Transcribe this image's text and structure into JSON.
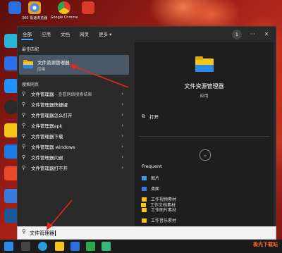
{
  "desktop": {
    "top_icons": [
      {
        "label": "",
        "color": "#2a6fe0",
        "icon": "shield-icon"
      },
      {
        "label": "360 极速浏览器",
        "color": "#4a90e2",
        "icon": "browser-icon"
      },
      {
        "label": "Google Chrome",
        "color": "#e8a020",
        "icon": "chrome-icon"
      },
      {
        "label": "",
        "color": "#d83a2a",
        "icon": "app-icon"
      }
    ],
    "side_icons_colors": [
      "#2ab3d8",
      "#2a70e8",
      "#1e90ff",
      "#2a6fe0",
      "#f5c518",
      "#1b7ce8",
      "#e84a2a",
      "#2a2a2a",
      "#1a5a9a",
      "#3a7ad8"
    ]
  },
  "start_menu": {
    "tabs": [
      "全部",
      "应用",
      "文档",
      "网页",
      "更多"
    ],
    "more_chevron": "▾",
    "notification_count": "1",
    "best_match_label": "最佳匹配",
    "best_match": {
      "title": "文件资源管理器",
      "subtitle": "应用"
    },
    "web_label": "搜索网页",
    "web_results": [
      {
        "text": "文件管理器",
        "hint": " - 查看网络搜索结果"
      },
      {
        "text": "文件管理器快捷键",
        "hint": ""
      },
      {
        "text": "文件管理器怎么打开",
        "hint": ""
      },
      {
        "text": "文件管理器apk",
        "hint": ""
      },
      {
        "text": "文件管理器下载",
        "hint": ""
      },
      {
        "text": "文件管理器 windows",
        "hint": ""
      },
      {
        "text": "文件管理器闪退",
        "hint": ""
      },
      {
        "text": "文件管理器打不开",
        "hint": ""
      }
    ],
    "preview": {
      "app_name": "文件资源管理器",
      "app_type": "应用",
      "open_label": "打开",
      "frequent_label": "Frequent",
      "frequent_items": [
        {
          "label": "图片",
          "icon": "pictures-icon"
        },
        {
          "label": "桌面",
          "icon": "desktop-folder-icon"
        },
        {
          "label": "工作视频素材",
          "icon": "folder-icon"
        },
        {
          "label": "工作图片素材",
          "icon": "folder-icon"
        },
        {
          "label": "工作音乐素材",
          "icon": "folder-icon"
        },
        {
          "label": "工作文档素材",
          "icon": "folder-icon"
        }
      ]
    }
  },
  "search": {
    "value": "文件管理器"
  },
  "colors": {
    "accent": "#4aa8ff",
    "arrow": "#e0281c",
    "folder": "#f5c518"
  },
  "watermark": "极光下载站"
}
